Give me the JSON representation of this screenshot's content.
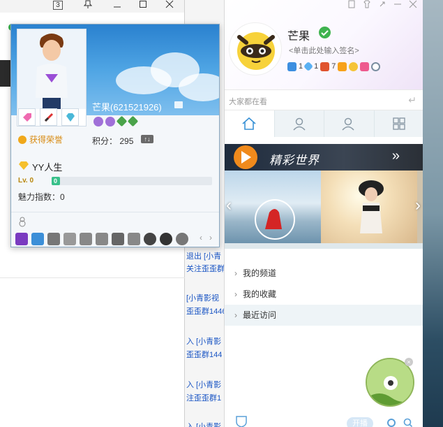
{
  "background_window": {
    "tab_count": "3"
  },
  "chat_log": {
    "lines": [
      "退出 [小青",
      "关注歪歪群",
      "[小青影视",
      "歪歪群1446",
      "入 [小青影",
      "歪歪群144",
      "入 [小青影",
      "注歪歪群1",
      "入 [小青影"
    ]
  },
  "profile": {
    "display_name": "芒果(621521926)",
    "honor_label": "获得荣誉",
    "points_label": "积分：",
    "points_value": "295",
    "yy_life_label": "YY人生",
    "level_label": "Lv. 0",
    "level_bar_value": "0",
    "level_progress": 0.03,
    "charm_label": "魅力指数：0"
  },
  "main_panel": {
    "username": "芒果",
    "signature_placeholder": "<单击此处输入签名>",
    "stat_values": [
      "1",
      "1",
      "7"
    ],
    "search_placeholder": "大家都在看",
    "banner_title": "精彩世界",
    "menu_items": [
      "我的频道",
      "我的收藏",
      "最近访问"
    ],
    "live_button": "开播"
  },
  "colors": {
    "accent_green": "#3fb34f",
    "honor_orange": "#d88b12",
    "level_bar": "#38c08a"
  }
}
